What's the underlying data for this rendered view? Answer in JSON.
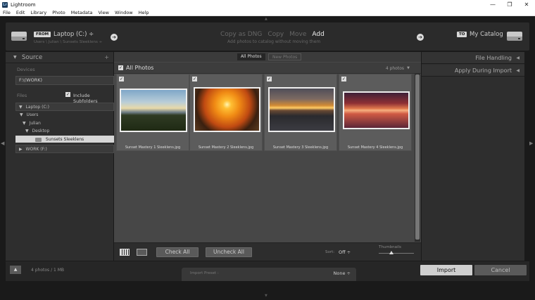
{
  "window": {
    "title": "Lightroom",
    "logo_text": "Lr",
    "minimize": "—",
    "maximize": "❐",
    "close": "✕"
  },
  "menu": [
    "File",
    "Edit",
    "Library",
    "Photo",
    "Metadata",
    "View",
    "Window",
    "Help"
  ],
  "header": {
    "from_tag": "FROM",
    "source_name": "Laptop (C:) ÷",
    "source_path": "Users \\ Julian \\ Sunsets Sleeklens ÷",
    "modes": [
      "Copy as DNG",
      "Copy",
      "Move",
      "Add"
    ],
    "active_mode": "Add",
    "mode_hint": "Add photos to catalog without moving them",
    "to_tag": "TO",
    "destination_name": "My Catalog"
  },
  "source_panel": {
    "title": "Source",
    "add": "+",
    "devices_label": "Devices",
    "device": "F:\\(WORK)",
    "files_label": "Files",
    "include_subfolders": "Include Subfolders",
    "tree": [
      {
        "label": "Laptop (C:)",
        "tri": "▼"
      },
      {
        "label": "Users",
        "tri": "▼"
      },
      {
        "label": "Julian",
        "tri": "▼"
      },
      {
        "label": "Desktop",
        "tri": "▼"
      },
      {
        "label": "Sunsets Sleeklens"
      },
      {
        "label": "WORK (F:)",
        "tri": "▶"
      }
    ]
  },
  "grid": {
    "tabs": [
      "All Photos",
      "New Photos"
    ],
    "heading": "All Photos",
    "count": "4 photos",
    "photos": [
      {
        "name": "Sunset Mastery 1 Sleeklens.jpg"
      },
      {
        "name": "Sunset Mastery 2 Sleeklens.jpg"
      },
      {
        "name": "Sunset Mastery 3 Sleeklens.jpg"
      },
      {
        "name": "Sunset Mastery 4 Sleeklens.jpg"
      }
    ],
    "check_all": "Check All",
    "uncheck_all": "Uncheck All",
    "sort_label": "Sort:",
    "sort_value": "Off ÷",
    "thumbnails_label": "Thumbnails"
  },
  "right_panel": {
    "sections": [
      "File Handling",
      "Apply During Import"
    ]
  },
  "bottom": {
    "collapse": "▲",
    "photo_count": "4 photos / 1 MB",
    "preset_label": "Import Preset :",
    "preset_value": "None ÷",
    "import": "Import",
    "cancel": "Cancel"
  },
  "colors": {
    "panel": "#2e2e2e",
    "grid": "#474747",
    "accent": "#d6d6d6"
  }
}
